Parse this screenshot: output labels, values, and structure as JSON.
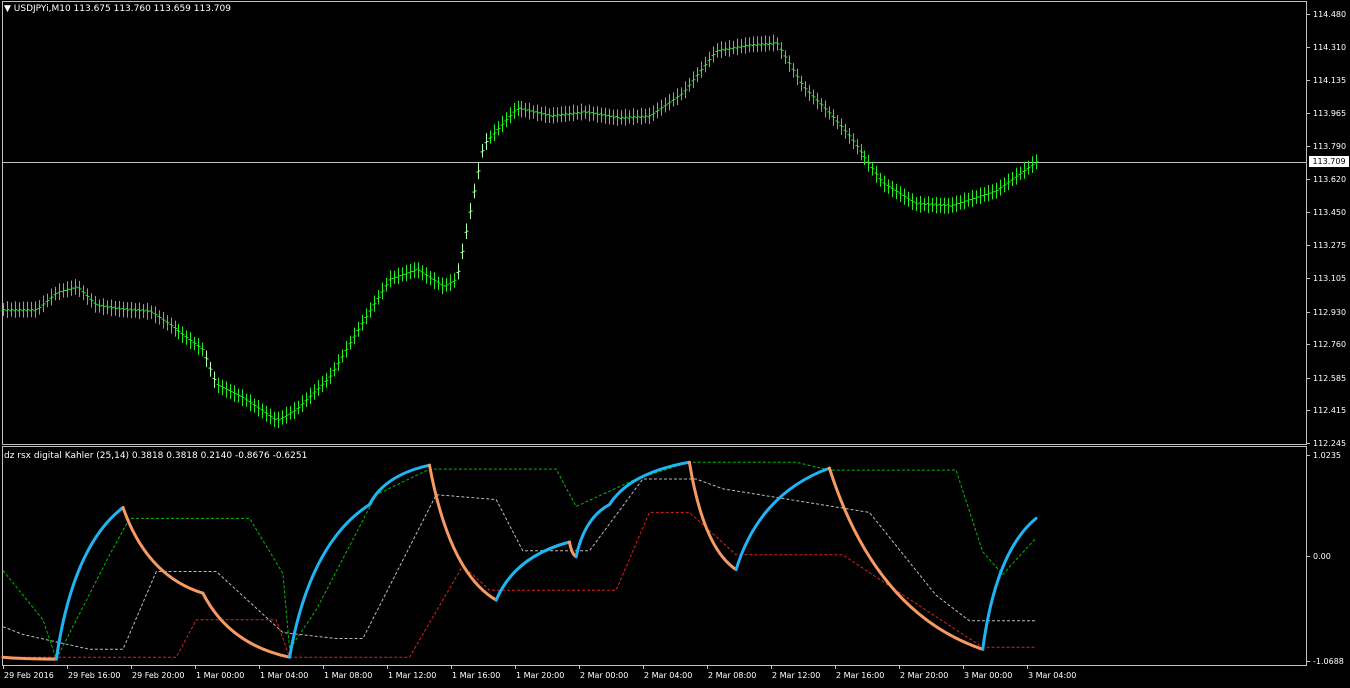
{
  "window": {
    "symbol_info": "USDJPYi,M10  113.675 113.760 113.659 113.709",
    "indicator_info": "dz rsx digital Kahler (25,14) 0.3818 0.3818 0.2140 -0.8676 -0.6251",
    "current_price_label": "113.709"
  },
  "colors": {
    "background": "#000000",
    "frame": "#c0c0c0",
    "candles_main": "#22ee22",
    "candles_highlight": "#aaffaa",
    "rsx_up": "#1fb4f2",
    "rsx_down": "#f79a62",
    "level_upper": "#00bb00",
    "level_middle": "#bbbbbb",
    "level_lower": "#dd2222"
  },
  "time_axis": {
    "labels": [
      "29 Feb 2016",
      "29 Feb 16:00",
      "29 Feb 20:00",
      "1 Mar 00:00",
      "1 Mar 04:00",
      "1 Mar 08:00",
      "1 Mar 12:00",
      "1 Mar 16:00",
      "1 Mar 20:00",
      "2 Mar 00:00",
      "2 Mar 04:00",
      "2 Mar 08:00",
      "2 Mar 12:00",
      "2 Mar 16:00",
      "2 Mar 20:00",
      "3 Mar 00:00",
      "3 Mar 04:00"
    ]
  },
  "chart_data": [
    {
      "type": "bar",
      "name": "USDJPYi,M10",
      "y_ticks": [
        "114.480",
        "114.310",
        "114.135",
        "113.965",
        "113.790",
        "113.620",
        "113.450",
        "113.275",
        "113.105",
        "112.930",
        "112.760",
        "112.585",
        "112.415",
        "112.245"
      ],
      "ylim": [
        112.245,
        114.48
      ],
      "current_price": 113.709,
      "x_range": [
        0,
        155
      ],
      "close_path": [
        [
          0,
          112.94
        ],
        [
          5,
          112.94
        ],
        [
          8,
          113.03
        ],
        [
          11,
          113.06
        ],
        [
          14,
          112.96
        ],
        [
          18,
          112.94
        ],
        [
          22,
          112.93
        ],
        [
          25,
          112.86
        ],
        [
          30,
          112.73
        ],
        [
          32,
          112.55
        ],
        [
          36,
          112.48
        ],
        [
          39,
          112.41
        ],
        [
          41,
          112.36
        ],
        [
          44,
          112.42
        ],
        [
          49,
          112.59
        ],
        [
          54,
          112.88
        ],
        [
          58,
          113.1
        ],
        [
          62,
          113.15
        ],
        [
          66,
          113.06
        ],
        [
          68,
          113.1
        ],
        [
          72,
          113.8
        ],
        [
          77,
          113.99
        ],
        [
          82,
          113.95
        ],
        [
          87,
          113.97
        ],
        [
          92,
          113.94
        ],
        [
          97,
          113.95
        ],
        [
          102,
          114.07
        ],
        [
          107,
          114.29
        ],
        [
          112,
          114.32
        ],
        [
          116,
          114.33
        ],
        [
          120,
          114.1
        ],
        [
          124,
          113.96
        ],
        [
          127,
          113.84
        ],
        [
          132,
          113.6
        ],
        [
          137,
          113.49
        ],
        [
          142,
          113.48
        ],
        [
          149,
          113.56
        ],
        [
          155,
          113.71
        ]
      ]
    },
    {
      "type": "line",
      "name": "dz rsx digital Kahler (25,14)",
      "y_ticks": [
        "1.0235",
        "0.00",
        "-1.0688"
      ],
      "ylim": [
        -1.0688,
        1.0235
      ],
      "x_range": [
        0,
        155
      ],
      "series": [
        {
          "name": "rsx",
          "points": [
            [
              0,
              -1.03
            ],
            [
              8,
              -1.05
            ],
            [
              18,
              0.49
            ],
            [
              30,
              -0.38
            ],
            [
              43,
              -1.03
            ],
            [
              55,
              0.52
            ],
            [
              64,
              0.92
            ],
            [
              74,
              -0.45
            ],
            [
              85,
              0.14
            ],
            [
              86,
              -0.01
            ],
            [
              91,
              0.52
            ],
            [
              103,
              0.95
            ],
            [
              110,
              -0.14
            ],
            [
              124,
              0.89
            ],
            [
              147,
              -0.95
            ],
            [
              155,
              0.38
            ]
          ]
        },
        {
          "name": "upper-level",
          "points": [
            [
              0,
              -0.15
            ],
            [
              6,
              -0.65
            ],
            [
              8,
              -1.05
            ],
            [
              16,
              0.01
            ],
            [
              19,
              0.38
            ],
            [
              37,
              0.38
            ],
            [
              42,
              -0.18
            ],
            [
              43,
              -0.95
            ],
            [
              47,
              -0.55
            ],
            [
              56,
              0.62
            ],
            [
              64,
              0.88
            ],
            [
              83,
              0.88
            ],
            [
              86,
              0.5
            ],
            [
              95,
              0.78
            ],
            [
              103,
              0.95
            ],
            [
              119,
              0.95
            ],
            [
              124,
              0.87
            ],
            [
              143,
              0.87
            ],
            [
              147,
              0.04
            ],
            [
              150,
              -0.19
            ],
            [
              155,
              0.18
            ]
          ]
        },
        {
          "name": "middle-level",
          "points": [
            [
              0,
              -0.72
            ],
            [
              3,
              -0.8
            ],
            [
              13,
              -0.95
            ],
            [
              18,
              -0.95
            ],
            [
              23,
              -0.16
            ],
            [
              32,
              -0.16
            ],
            [
              42,
              -0.78
            ],
            [
              50,
              -0.84
            ],
            [
              54,
              -0.84
            ],
            [
              65,
              0.62
            ],
            [
              74,
              0.57
            ],
            [
              78,
              0.05
            ],
            [
              88,
              0.05
            ],
            [
              96,
              0.78
            ],
            [
              104,
              0.78
            ],
            [
              108,
              0.68
            ],
            [
              130,
              0.44
            ],
            [
              140,
              -0.4
            ],
            [
              145,
              -0.66
            ],
            [
              155,
              -0.66
            ]
          ]
        },
        {
          "name": "lower-level",
          "points": [
            [
              0,
              -1.03
            ],
            [
              26,
              -1.03
            ],
            [
              29,
              -0.65
            ],
            [
              41,
              -0.65
            ],
            [
              43,
              -1.03
            ],
            [
              61,
              -1.03
            ],
            [
              69,
              -0.1
            ],
            [
              73,
              -0.35
            ],
            [
              92,
              -0.35
            ],
            [
              97,
              0.44
            ],
            [
              103,
              0.44
            ],
            [
              110,
              0.01
            ],
            [
              126,
              0.01
            ],
            [
              138,
              -0.53
            ],
            [
              147,
              -0.93
            ],
            [
              155,
              -0.93
            ]
          ]
        }
      ]
    }
  ]
}
